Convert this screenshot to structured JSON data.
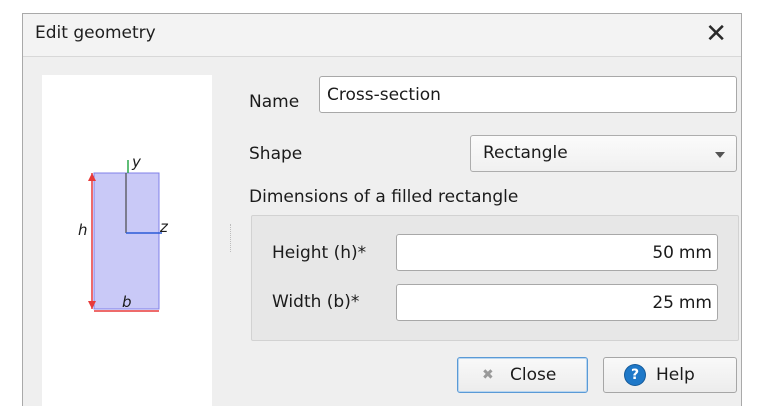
{
  "window": {
    "title": "Edit geometry",
    "close_glyph": "✕"
  },
  "preview": {
    "y_label": "y",
    "z_label": "z",
    "h_label": "h",
    "b_label": "b"
  },
  "form": {
    "name_label": "Name",
    "name_value": "Cross-section",
    "shape_label": "Shape",
    "shape_value": "Rectangle",
    "group_title": "Dimensions of a filled rectangle",
    "height_label": "Height (h)*",
    "height_value": "50",
    "height_unit": "mm",
    "width_label": "Width (b)*",
    "width_value": "25",
    "width_unit": "mm"
  },
  "buttons": {
    "close_label": "Close",
    "help_label": "Help",
    "close_icon": "✖",
    "help_icon": "?"
  },
  "colors": {
    "shape_fill": "#c9c9f7",
    "shape_stroke": "#8080e8",
    "dim_red": "#e83a3a",
    "axis_blue": "#2a5bd7"
  }
}
